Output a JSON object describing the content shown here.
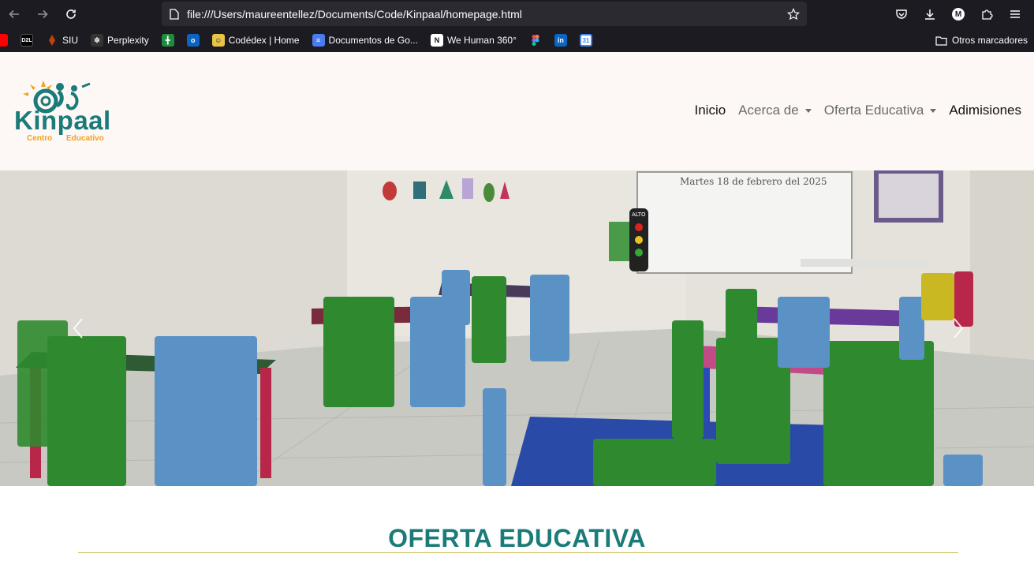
{
  "browser": {
    "url": "file:///Users/maureentellez/Documents/Code/Kinpaal/homepage.html",
    "avatar_letter": "M",
    "bookmarks": [
      {
        "label": "",
        "icon": "youtube-icon",
        "color": "#ff0000"
      },
      {
        "label": "",
        "icon": "d2l-icon",
        "color": "#000000",
        "glyph": "D2L"
      },
      {
        "label": "SIU",
        "icon": "siu-icon",
        "color": "#c2410c"
      },
      {
        "label": "Perplexity",
        "icon": "perplexity-icon",
        "color": "#222222"
      },
      {
        "label": "",
        "icon": "google-sheets-icon",
        "color": "#1e8e3e"
      },
      {
        "label": "",
        "icon": "outlook-icon",
        "color": "#0a64c2"
      },
      {
        "label": "Codédex | Home",
        "icon": "codedex-icon",
        "color": "#e8c547"
      },
      {
        "label": "Documentos de Go...",
        "icon": "google-docs-icon",
        "color": "#4a7cf0"
      },
      {
        "label": "We Human 360°",
        "icon": "notion-icon",
        "color": "#ffffff"
      },
      {
        "label": "",
        "icon": "figma-icon",
        "color": "#a259ff"
      },
      {
        "label": "",
        "icon": "linkedin-icon",
        "color": "#0a66c2"
      },
      {
        "label": "",
        "icon": "google-calendar-icon",
        "color": "#4285f4",
        "glyph": "31"
      }
    ],
    "other_bookmarks": "Otros marcadores"
  },
  "site": {
    "logo_text": "Kinpaal",
    "logo_sub_1": "Centro",
    "logo_sub_2": "Educativo",
    "nav": [
      {
        "label": "Inicio",
        "dropdown": false
      },
      {
        "label": "Acerca de",
        "dropdown": true
      },
      {
        "label": "Oferta Educativa",
        "dropdown": true
      },
      {
        "label": "Adimisiones",
        "dropdown": false
      }
    ],
    "hero": {
      "whiteboard_text": "Martes 18 de febrero del 2025",
      "sign_text": "ALTO"
    },
    "section_title": "OFERTA EDUCATIVA"
  },
  "colors": {
    "brand_teal": "#1b7b78",
    "accent_orange": "#f2a21c",
    "rule_gold": "#c9b94a"
  }
}
